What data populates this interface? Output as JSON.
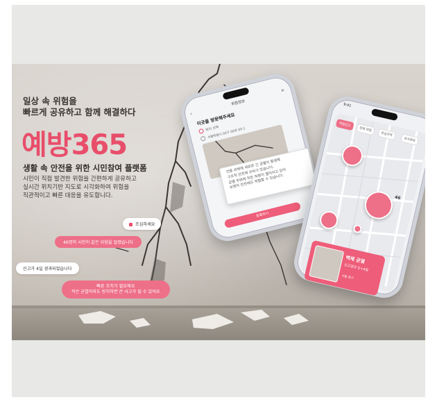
{
  "poster": {
    "headline_line1": "일상 속 위험을",
    "headline_line2": "빠르게 공유하고 함께 해결하다",
    "brand": "예방365",
    "subhead": "생활 속 안전을 위한 시민참여 플랫폼",
    "desc_line1": "시민이 직접 발견한 위험을 간편하게 공유하고",
    "desc_line2": "실시간 위치기반 지도로 시각화하여 위험을",
    "desc_line3": "직관적이고 빠른 대응을 유도합니다."
  },
  "bubbles": {
    "careful": "조심하세요",
    "shared": "46명의 시민이 같은 위험을 알렸습니다",
    "elapsed": "신고가 4일 경과되었습니다",
    "warning_line1": "작은 균열이라도 방치하면 큰 사고가 될 수 있어요",
    "warning_line2": "빠른 조치가 필요해요"
  },
  "phone_left": {
    "header": "위험정보",
    "title": "이곳을 방문해주세요",
    "row1": "위치 선택",
    "row2": "서울특별시 00구 00로 00-1",
    "popup_line1": "건물 외벽에 세로로 긴 균열이 발생해",
    "popup_line2": "구조적 안전에 우려가 있습니다.",
    "popup_line3": "균열 주변에 작은 파편이 떨어지고 있어",
    "popup_line4": "보행자 안전에도 위험할 수 있습니다.",
    "button": "등록하기"
  },
  "phone_right": {
    "tabs": [
      "위험신고",
      "전체 위험",
      "관심지역",
      "공사정보"
    ],
    "active_tab": 0,
    "cluster_count": "46",
    "card_title": "벽체 균열",
    "card_sub": "신고경과 D+4일",
    "card_loc": "서울 중구",
    "status_time": "9:41"
  },
  "colors": {
    "accent": "#e84e6a",
    "pink_bubble": "#ee6f88",
    "text_dark": "#3a3431"
  }
}
